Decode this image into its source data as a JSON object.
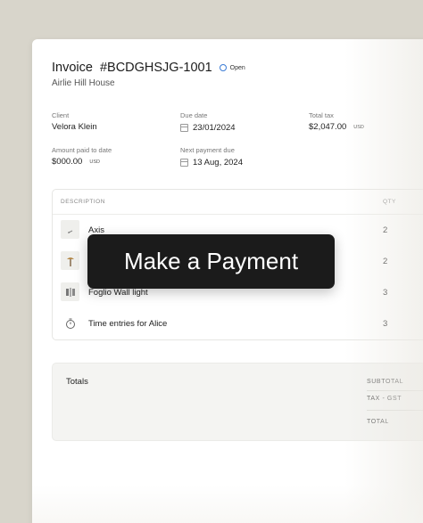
{
  "invoice": {
    "label": "Invoice",
    "number": "#BCDGHSJG-1001",
    "status": "Open",
    "subtitle": "Airlie Hill House"
  },
  "fields": {
    "client": {
      "label": "Client",
      "value": "Velora Klein"
    },
    "due_date": {
      "label": "Due date",
      "value": "23/01/2024"
    },
    "total_tax": {
      "label": "Total tax",
      "value": "$2,047.00",
      "currency": "USD"
    },
    "amount_paid": {
      "label": "Amount paid to date",
      "value": "$000.00",
      "currency": "USD"
    },
    "next_payment": {
      "label": "Next payment due",
      "value": "13 Aug, 2024"
    }
  },
  "items": {
    "headers": {
      "description": "DESCRIPTION",
      "qty": "QTY"
    },
    "rows": [
      {
        "name": "Axis",
        "qty": "2",
        "icon": "lamp-icon"
      },
      {
        "name": "",
        "qty": "2",
        "icon": "floor-lamp-icon"
      },
      {
        "name": "Foglio Wall light",
        "qty": "3",
        "icon": "wall-light-icon"
      },
      {
        "name": "Time entries for Alice",
        "qty": "3",
        "icon": "stopwatch-icon"
      }
    ]
  },
  "totals": {
    "title": "Totals",
    "subtotal": "SUBTOTAL",
    "tax": "TAX - GST",
    "total": "TOTAL"
  },
  "cta": {
    "label": "Make a Payment"
  },
  "colors": {
    "background": "#d8d5cb",
    "button": "#1b1b1b",
    "status_ring": "#3a7bd5"
  }
}
